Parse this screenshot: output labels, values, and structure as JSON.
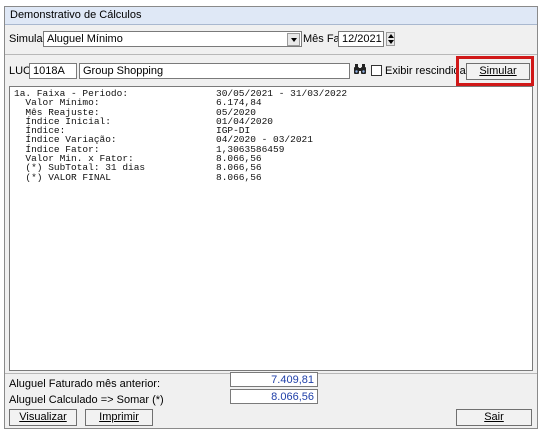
{
  "window": {
    "title": "Demonstrativo de Cálculos"
  },
  "filter": {
    "simular_label": "Simular",
    "simular_value": "Aluguel Mínimo",
    "mes_fat_label": "Mês Fat",
    "mes_fat_value": "12/2021"
  },
  "luc": {
    "label": "LUC",
    "code": "1018A",
    "name": "Group Shopping",
    "exibir_label": "Exibir rescindidas",
    "exibir_checked": false,
    "simular_button": "Simular"
  },
  "report": {
    "rows": [
      {
        "key": "1a. Faixa - Periodo:",
        "value": "30/05/2021 - 31/03/2022"
      },
      {
        "key": "  Valor Mínimo:",
        "value": "6.174,84"
      },
      {
        "key": "  Mês Reajuste:",
        "value": "05/2020"
      },
      {
        "key": "  Índice Inicial:",
        "value": "01/04/2020"
      },
      {
        "key": "  Índice:",
        "value": "IGP-DI"
      },
      {
        "key": "  Índice Variação:",
        "value": "04/2020 - 03/2021"
      },
      {
        "key": "  Índice Fator:",
        "value": "1,3063586459"
      },
      {
        "key": "  Valor Min. x Fator:",
        "value": "8.066,56"
      },
      {
        "key": "  (*) SubTotal: 31 dias",
        "value": "8.066,56"
      },
      {
        "key": "  (*) VALOR FINAL",
        "value": "8.066,56"
      }
    ]
  },
  "totals": {
    "faturado_label": "Aluguel Faturado mês anterior:",
    "faturado_value": "7.409,81",
    "calculado_label": "Aluguel Calculado => Somar (*)",
    "calculado_value": "8.066,56"
  },
  "buttons": {
    "visualizar": "Visualizar",
    "imprimir": "Imprimir",
    "sair": "Sair"
  },
  "colors": {
    "highlight": "#d01818",
    "titlebar": "#dfe8f6"
  }
}
